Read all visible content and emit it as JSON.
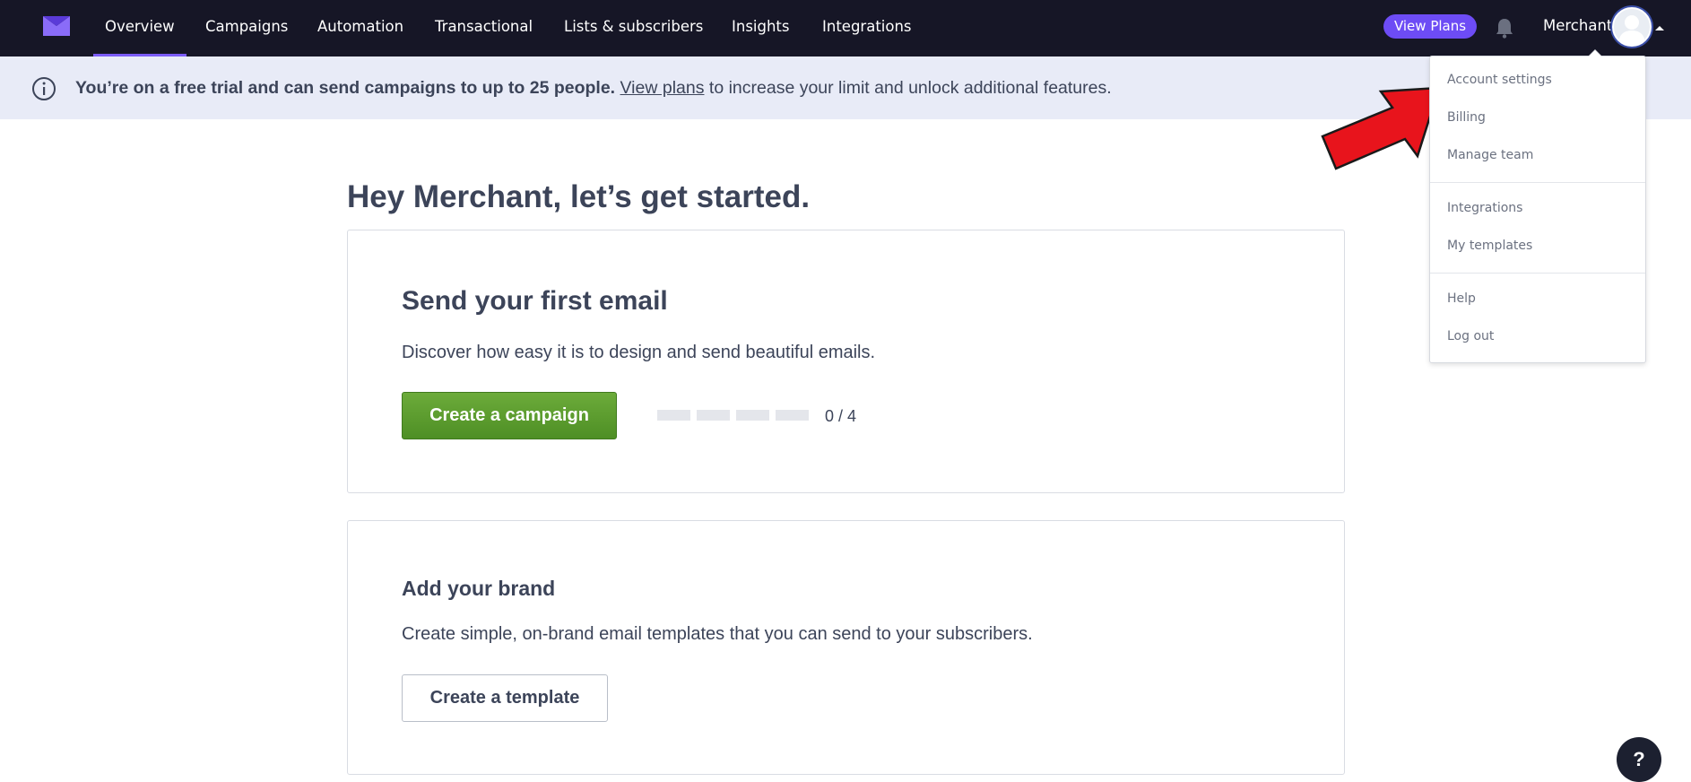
{
  "nav": {
    "items": [
      {
        "label": "Overview",
        "active": true
      },
      {
        "label": "Campaigns"
      },
      {
        "label": "Automation"
      },
      {
        "label": "Transactional"
      },
      {
        "label": "Lists & subscribers"
      },
      {
        "label": "Insights"
      },
      {
        "label": "Integrations"
      }
    ],
    "view_plans_label": "View Plans",
    "user_name": "Merchant",
    "logo_icon": "envelope-logo-icon",
    "bell_icon": "bell-icon",
    "accent_color": "#7b5cf5"
  },
  "banner": {
    "bold_text": "You’re on a free trial and can send campaigns to up to 25 people.",
    "link_text": "View plans",
    "rest_text": " to increase your limit and unlock additional features.",
    "icon": "info-icon"
  },
  "main": {
    "title": "Hey Merchant, let’s get started.",
    "card1": {
      "heading": "Send your first email",
      "description": "Discover how easy it is to design and send beautiful emails.",
      "button_label": "Create a campaign",
      "progress_done": 0,
      "progress_total": 4,
      "progress_label": "0 / 4"
    },
    "card2": {
      "heading": "Add your brand",
      "description": "Create simple, on-brand email templates that you can send to your subscribers.",
      "button_label": "Create a template"
    }
  },
  "dropdown": {
    "groups": [
      [
        "Account settings",
        "Billing",
        "Manage team"
      ],
      [
        "Integrations",
        "My templates"
      ],
      [
        "Help",
        "Log out"
      ]
    ]
  },
  "help_button_label": "?"
}
